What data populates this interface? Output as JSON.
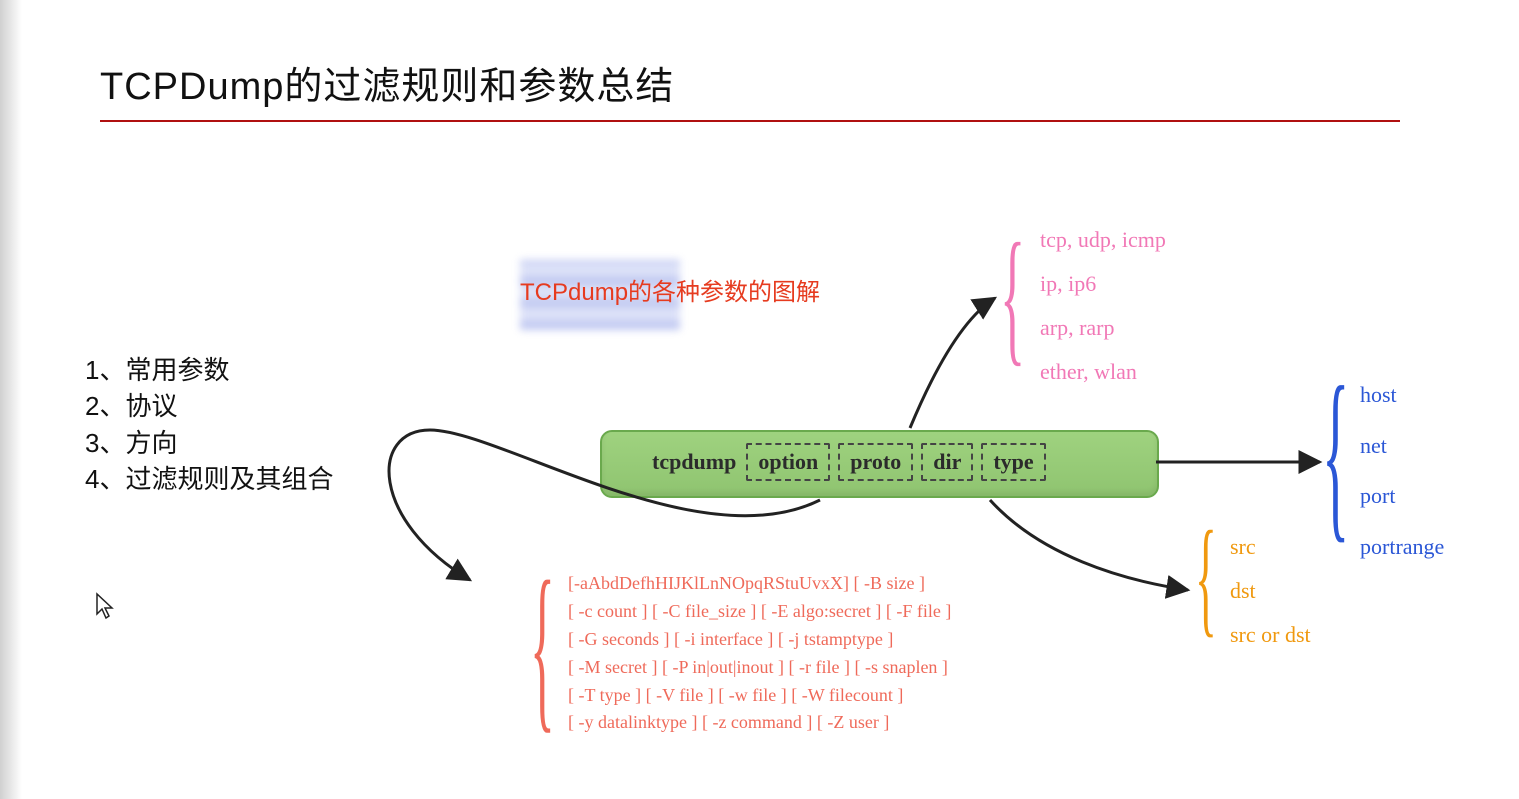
{
  "title": "TCPDump的过滤规则和参数总结",
  "caption": "TCPdump的各种参数的图解",
  "outline": [
    "1、常用参数",
    "2、协议",
    "3、方向",
    "4、过滤规则及其组合"
  ],
  "command": {
    "cmd": "tcpdump",
    "parts": [
      "option",
      "proto",
      "dir",
      "type"
    ]
  },
  "proto_items": [
    "tcp, udp, icmp",
    "ip, ip6",
    "arp, rarp",
    "ether, wlan"
  ],
  "type_items": [
    "host",
    "net",
    "port",
    "portrange"
  ],
  "dir_items": [
    "src",
    "dst",
    "src or dst"
  ],
  "option_lines": [
    "[-aAbdDefhHIJKlLnNOpqRStuUvxX] [ -B size ]",
    "[ -c count ] [ -C file_size ] [ -E algo:secret ] [ -F file ]",
    "[ -G seconds ] [ -i interface ] [ -j tstamptype ]",
    "[ -M secret ] [ -P in|out|inout ] [ -r file ] [ -s snaplen ]",
    "[ -T type ] [ -V file ] [ -w file ] [ -W filecount ]",
    "[ -y datalinktype ] [ -z command ] [ -Z user ]"
  ],
  "colors": {
    "proto": "#f178b6",
    "type": "#2b57d6",
    "dir": "#f0990f",
    "option": "#ef6a5a",
    "bar": "#8fc470",
    "title_rule": "#b01010",
    "caption": "#e63b1f"
  }
}
